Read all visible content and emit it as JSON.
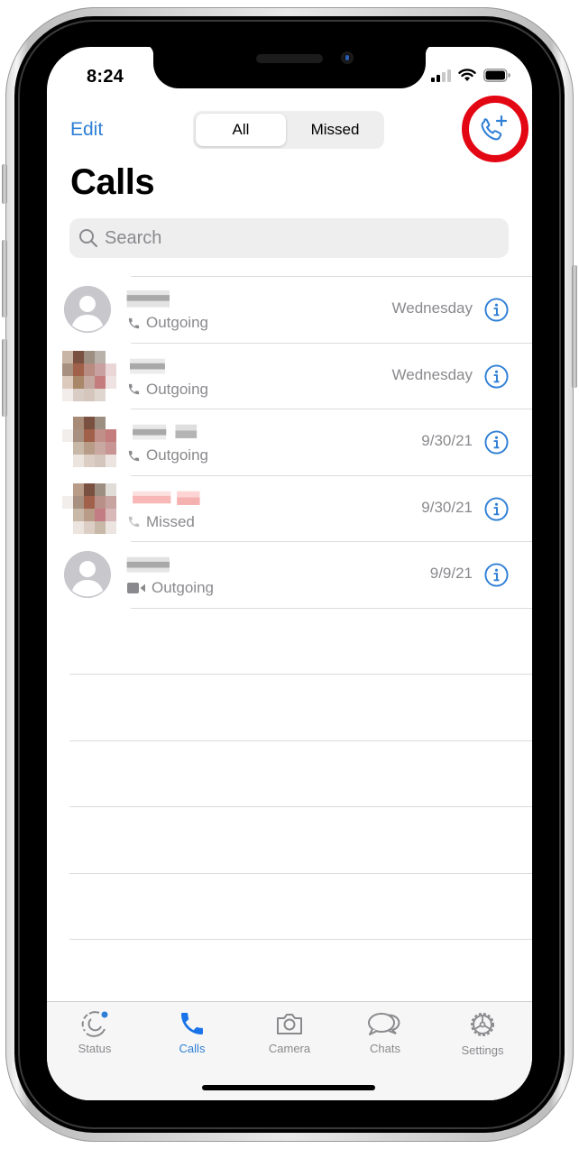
{
  "status_bar": {
    "time": "8:24",
    "signal_bars_active": 2,
    "signal_bars_total": 4,
    "wifi": true,
    "battery_percent": 100
  },
  "header": {
    "edit_label": "Edit",
    "segments": [
      {
        "label": "All",
        "selected": true
      },
      {
        "label": "Missed",
        "selected": false
      }
    ],
    "new_call_icon": "phone-plus-icon",
    "highlight_color": "#e30613"
  },
  "title": "Calls",
  "search": {
    "placeholder": "Search"
  },
  "calls": [
    {
      "name": "",
      "avatar": "default",
      "type_icon": "phone-icon",
      "type": "Outgoing",
      "date": "Wednesday",
      "missed": false
    },
    {
      "name": "",
      "avatar": "photo",
      "type_icon": "phone-icon",
      "type": "Outgoing",
      "date": "Wednesday",
      "missed": false
    },
    {
      "name": "",
      "avatar": "photo",
      "type_icon": "phone-icon",
      "type": "Outgoing",
      "date": "9/30/21",
      "missed": false
    },
    {
      "name": "",
      "avatar": "photo",
      "type_icon": "phone-icon",
      "type": "Missed",
      "date": "9/30/21",
      "missed": true
    },
    {
      "name": "",
      "avatar": "default",
      "type_icon": "video-icon",
      "type": "Outgoing",
      "date": "9/9/21",
      "missed": false
    }
  ],
  "tabbar": {
    "tabs": [
      {
        "label": "Status",
        "icon": "status-icon",
        "active": false,
        "badge_dot": true
      },
      {
        "label": "Calls",
        "icon": "phone-icon",
        "active": true
      },
      {
        "label": "Camera",
        "icon": "camera-icon",
        "active": false
      },
      {
        "label": "Chats",
        "icon": "chats-icon",
        "active": false
      },
      {
        "label": "Settings",
        "icon": "gear-icon",
        "active": false
      }
    ]
  },
  "colors": {
    "accent": "#2f7fd6",
    "secondary_text": "#8a8a8e",
    "missed_name": "#ff3b30"
  }
}
